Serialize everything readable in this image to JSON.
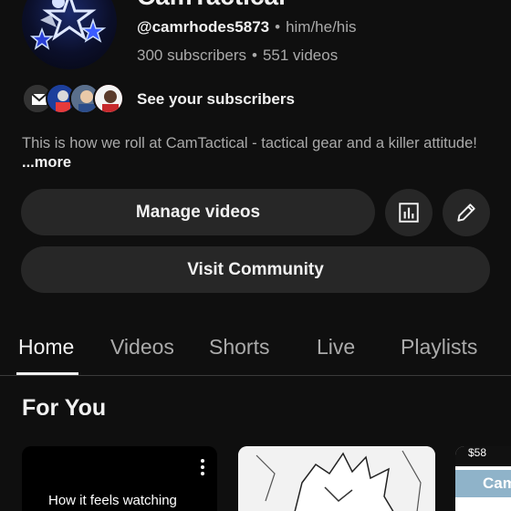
{
  "channel": {
    "name": "CamTactical",
    "handle": "@camrhodes5873",
    "pronouns": "him/he/his",
    "subscribers": "300 subscribers",
    "videos": "551 videos",
    "separator": "•"
  },
  "subscribers_link": "See your subscribers",
  "description": {
    "text": "This is how we roll at CamTactical - tactical gear and a killer attitude!",
    "more_label": "...more"
  },
  "actions": {
    "manage_videos": "Manage videos",
    "visit_community": "Visit Community",
    "analytics_icon": "bar-chart-icon",
    "edit_icon": "pencil-icon"
  },
  "tabs": [
    {
      "label": "Home",
      "active": true
    },
    {
      "label": "Videos",
      "active": false
    },
    {
      "label": "Shorts",
      "active": false
    },
    {
      "label": "Live",
      "active": false
    },
    {
      "label": "Playlists",
      "active": false
    }
  ],
  "section": {
    "title": "For You"
  },
  "cards": [
    {
      "caption": "How it feels watching"
    },
    {
      "caption": ""
    },
    {
      "price": "$58",
      "logo_text": "Cam"
    }
  ],
  "colors": {
    "background": "#0f0f0f",
    "button": "#272727",
    "text": "#f1f1f1",
    "muted": "#aaaaaa"
  }
}
